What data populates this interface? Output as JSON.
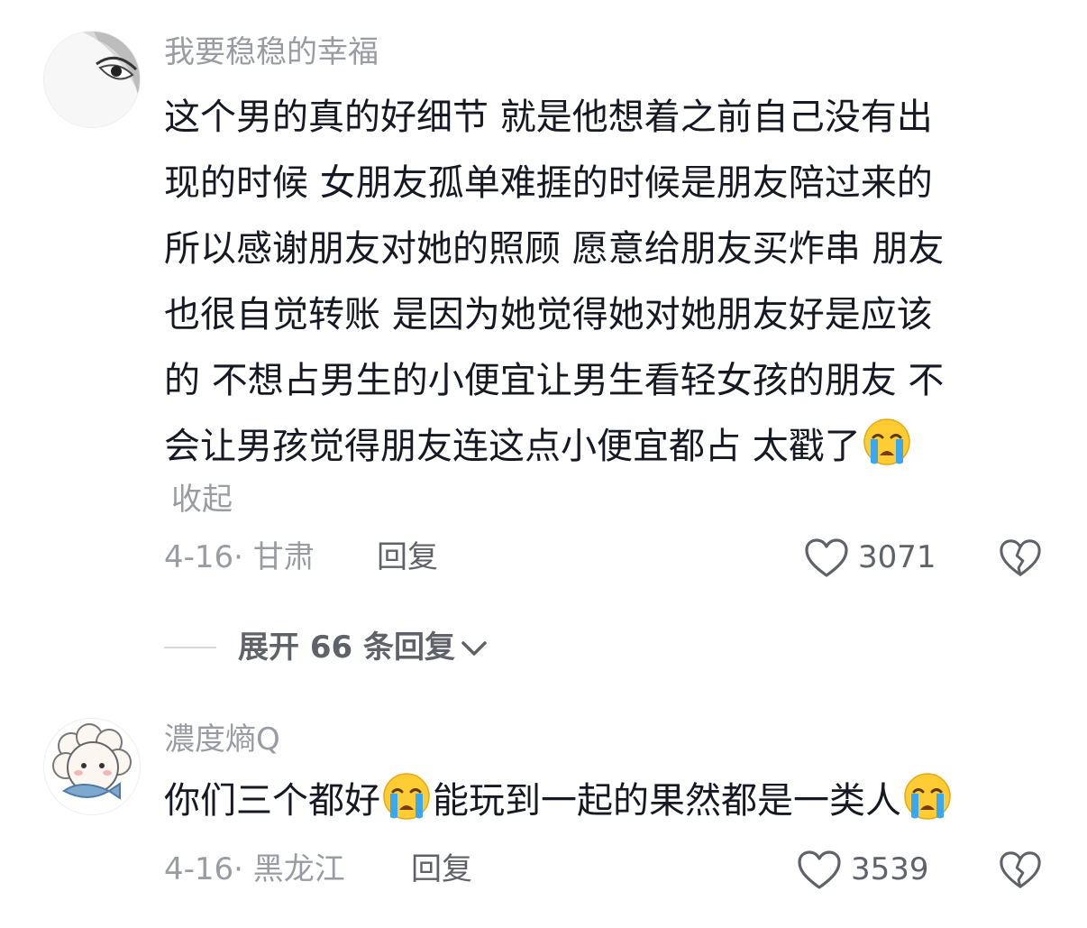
{
  "comments": [
    {
      "username": "我要稳稳的幸福",
      "content_lines": [
        "这个男的真的好细节 就是他想着之前自己没有出",
        "现的时候 女朋友孤单难捱的时候是朋友陪过来的",
        "所以感谢朋友对她的照顾 愿意给朋友买炸串 朋友",
        "也很自觉转账 是因为她觉得她对她朋友好是应该",
        "的 不想占男生的小便宜让男生看轻女孩的朋友 不",
        "会让男孩觉得朋友连这点小便宜都占 太戳了"
      ],
      "collapse_label": "收起",
      "date": "4-16",
      "separator": "·",
      "location": "甘肃",
      "reply_label": "回复",
      "like_count": "3071",
      "expand_replies_label": "展开 66 条回复"
    },
    {
      "username": "濃度熵Q",
      "content_part1": "你们三个都好",
      "content_part2": "能玩到一起的果然都是一类人",
      "date": "4-16",
      "separator": "·",
      "location": "黑龙江",
      "reply_label": "回复",
      "like_count": "3539"
    }
  ],
  "icons": {
    "emoji": "crying-emoji",
    "like": "heart-outline-icon",
    "dislike": "broken-heart-icon",
    "expand": "chevron-down-icon"
  },
  "colors": {
    "text_primary": "#161823",
    "text_secondary": "#9a9ca3",
    "text_action": "#606269",
    "emoji_face": "#ffcc33",
    "emoji_tear": "#3aa8f0"
  }
}
